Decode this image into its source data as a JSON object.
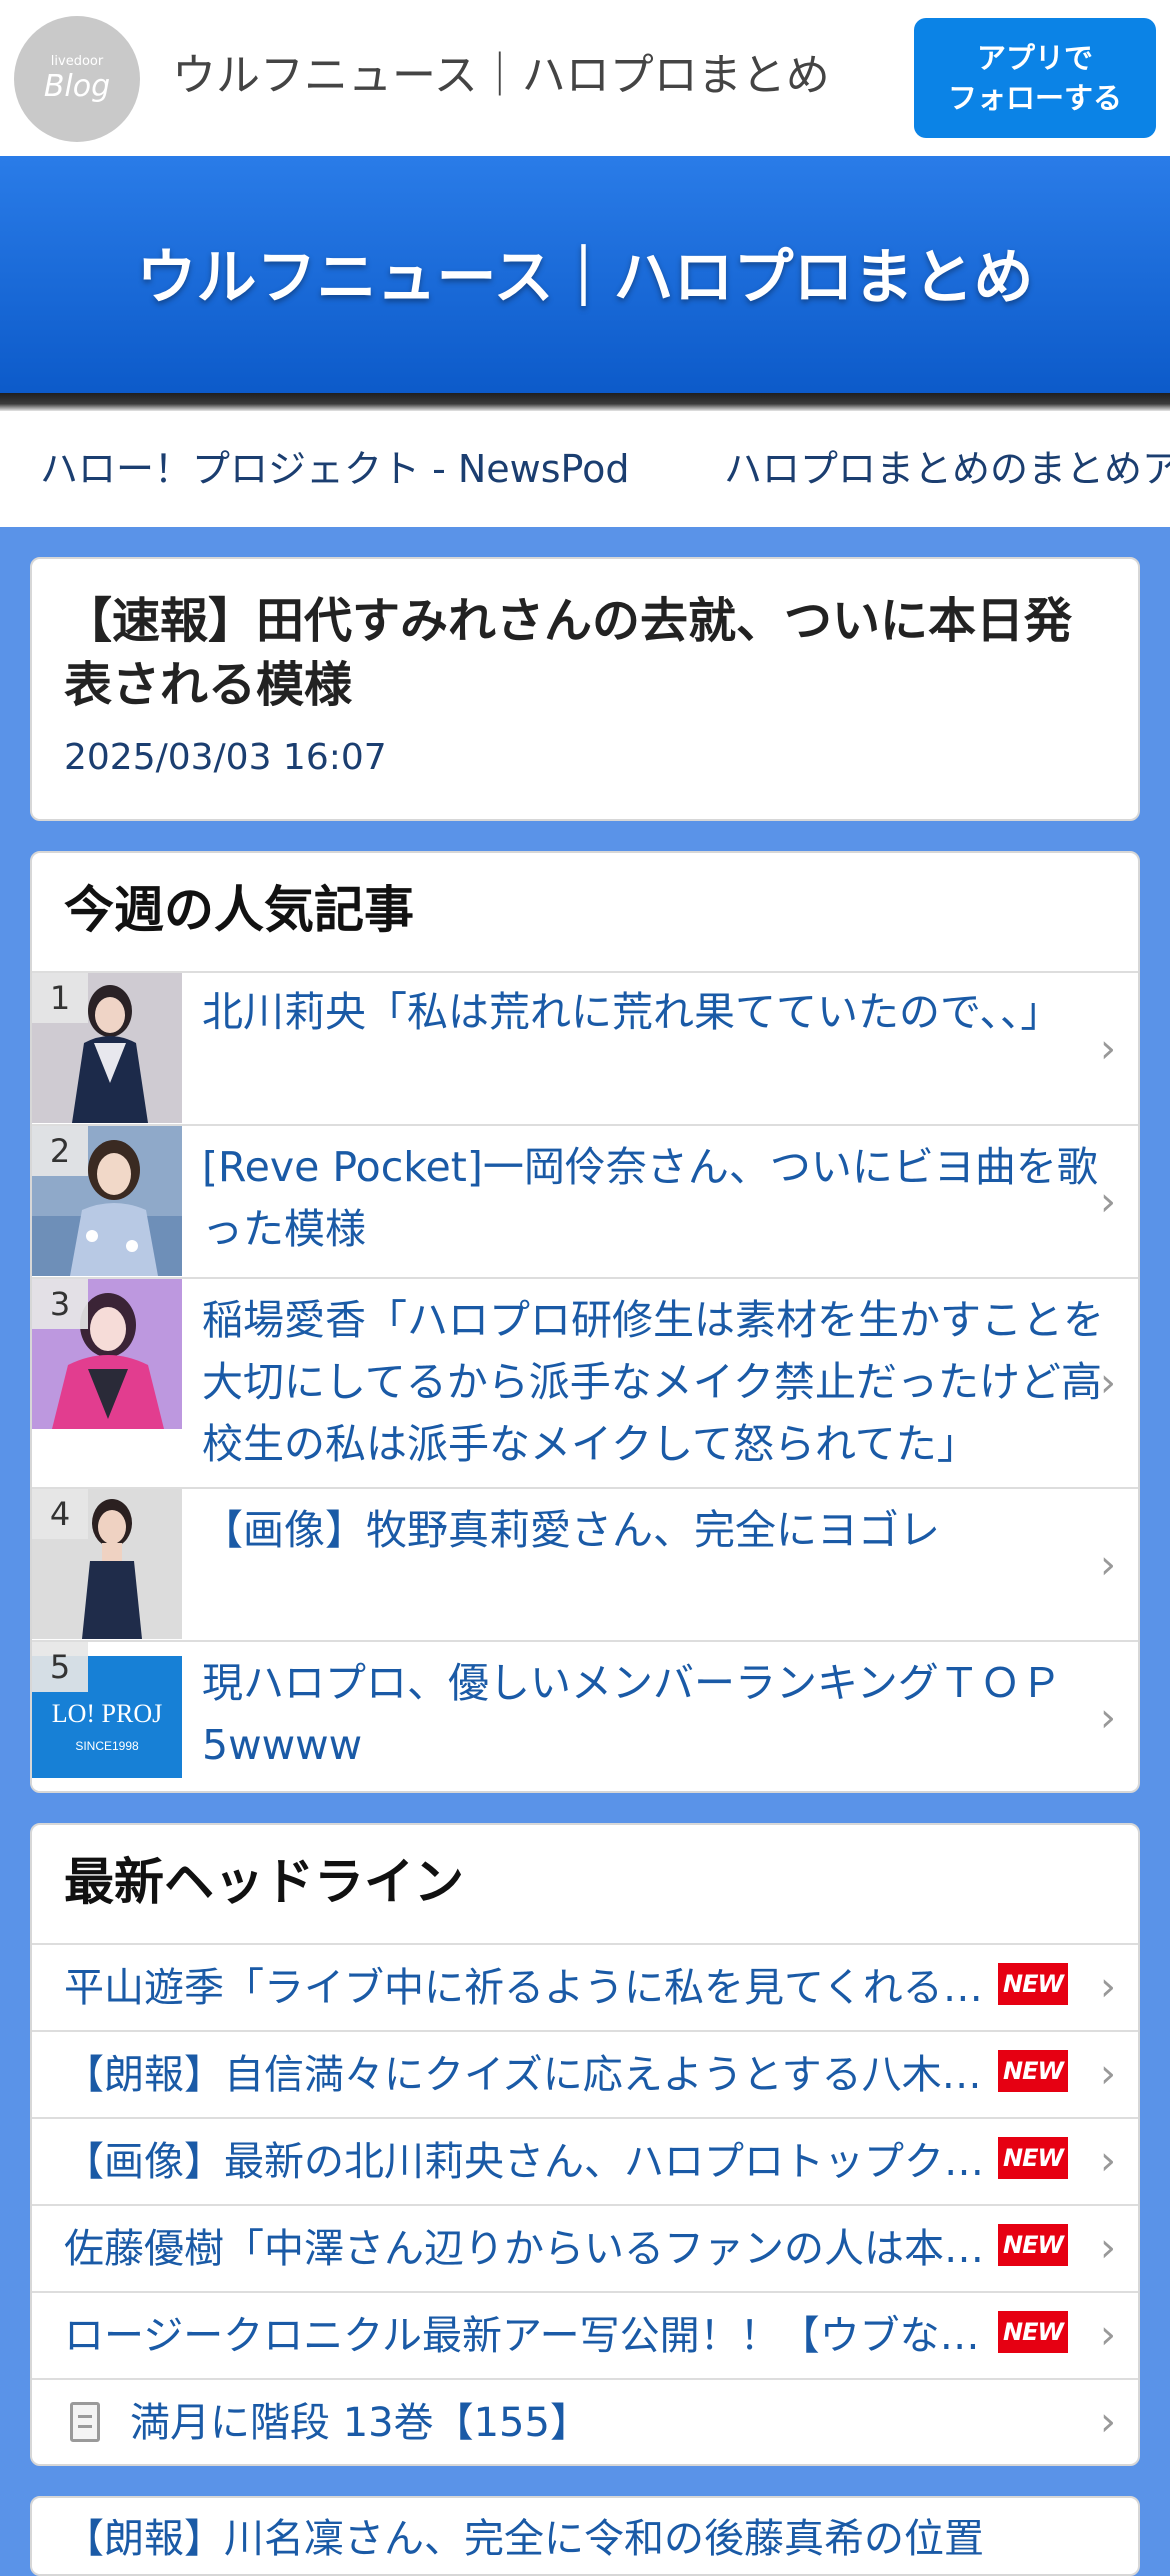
{
  "header": {
    "logo_small": "livedoor",
    "logo_big": "Blog",
    "site_title": "ウルフニュース｜ハロプロまとめ",
    "follow_button_line1": "アプリで",
    "follow_button_line2": "フォローする"
  },
  "banner": {
    "title": "ウルフニュース｜ハロプロまとめ"
  },
  "links": [
    "ハロー！プロジェクト - NewsPod",
    "ハロプロまとめのまとめア"
  ],
  "headline_article": {
    "title": "【速報】田代すみれさんの去就、ついに本日発表される模様",
    "date": "2025/03/03 16:07"
  },
  "popular": {
    "heading": "今週の人気記事",
    "items": [
      {
        "rank": "1",
        "title": "北川莉央「私は荒れに荒れ果てていたので、、」"
      },
      {
        "rank": "2",
        "title": "[Reve Pocket]一岡伶奈さん、ついにビヨ曲を歌った模様"
      },
      {
        "rank": "3",
        "title": "稲場愛香「ハロプロ研修生は素材を生かすことを大切にしてるから派手なメイク禁止だったけど高校生の私は派手なメイクして怒られてた」"
      },
      {
        "rank": "4",
        "title": "【画像】牧野真莉愛さん、完全にヨゴレ"
      },
      {
        "rank": "5",
        "title": "現ハロプロ、優しいメンバーランキングＴＯＰ5wwww"
      }
    ],
    "thumb5_text_main": "LO! PROJ",
    "thumb5_text_sub": "SINCE1998"
  },
  "latest": {
    "heading": "最新ヘッドライン",
    "badge": "NEW",
    "items": [
      "平山遊季「ライブ中に祈るように私を見てくれる人がいる」",
      "【朗報】自信満々にクイズに応えようとする八木栞さん",
      "【画像】最新の北川莉央さん、ハロプロトップクラスのスタイル",
      "佐藤優樹「中澤さん辺りからいるファンの人は本当に凄い」",
      "ロージークロニクル最新アー写公開！！【ウブな恋】"
    ],
    "doc_item": "満月に階段 13巻【155】"
  },
  "next_card": {
    "title": "【朗報】川名凜さん、完全に令和の後藤真希の位置"
  },
  "colors": {
    "page_bg": "#5a93e8",
    "banner": "#0c5ac9",
    "follow_button": "#0b83e6",
    "link_text": "#1a5aa6",
    "new_badge": "#e60012"
  },
  "icons": [
    "chevron-right-icon",
    "document-icon"
  ]
}
